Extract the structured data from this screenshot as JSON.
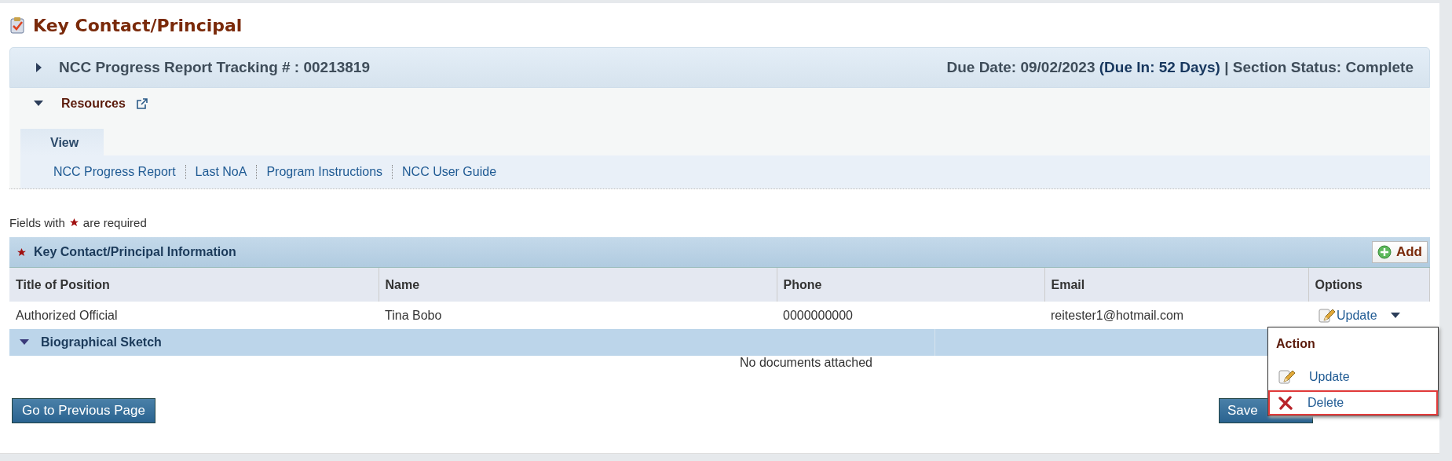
{
  "page_title": "Key Contact/Principal",
  "tracking": {
    "label": "NCC Progress Report Tracking # : 00213819",
    "expanded": false,
    "due_date": "Due Date: 09/02/2023",
    "due_in": "(Due In: 52 Days)",
    "separator": "|",
    "section_status": "Section Status: Complete"
  },
  "resources": {
    "title": "Resources",
    "expanded": true,
    "tabs": [
      {
        "label": "View",
        "selected": true
      }
    ],
    "links": [
      "NCC Progress Report",
      "Last NoA",
      "Program Instructions",
      "NCC User Guide"
    ]
  },
  "required_note": {
    "before": "Fields with",
    "after": "are required"
  },
  "contacts": {
    "title": "Key Contact/Principal Information",
    "add_button": "Add",
    "columns": [
      "Title of Position",
      "Name",
      "Phone",
      "Email",
      "Options"
    ],
    "rows": [
      {
        "cells": [
          "Authorized Official",
          "Tina Bobo",
          "0000000000",
          "reitester1@hotmail.com"
        ],
        "option": "Update"
      }
    ]
  },
  "action_menu": {
    "title": "Action",
    "items": [
      {
        "label": "Update",
        "kind": "update",
        "selected": false
      },
      {
        "label": "Delete",
        "kind": "delete",
        "selected": true
      }
    ]
  },
  "bio_sketch": {
    "title": "Biographical Sketch",
    "expanded": true,
    "empty_text": "No documents attached"
  },
  "buttons": [
    {
      "label": "Go to Previous Page"
    },
    {
      "label": "Save"
    }
  ]
}
